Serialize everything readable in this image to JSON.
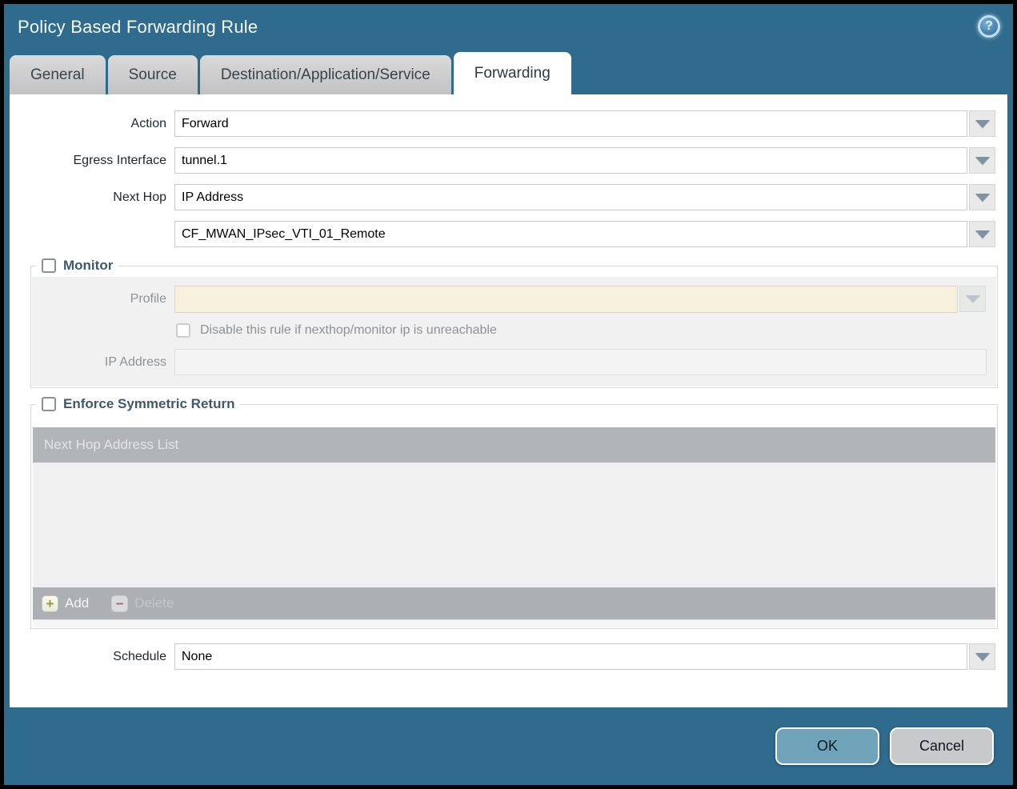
{
  "dialog": {
    "title": "Policy Based Forwarding Rule",
    "tabs": [
      {
        "label": "General"
      },
      {
        "label": "Source"
      },
      {
        "label": "Destination/Application/Service"
      },
      {
        "label": "Forwarding"
      }
    ],
    "active_tab": "Forwarding"
  },
  "form": {
    "action": {
      "label": "Action",
      "value": "Forward"
    },
    "egress_interface": {
      "label": "Egress Interface",
      "value": "tunnel.1"
    },
    "next_hop": {
      "label": "Next Hop",
      "value": "IP Address"
    },
    "next_hop_address": {
      "value": "CF_MWAN_IPsec_VTI_01_Remote"
    },
    "schedule": {
      "label": "Schedule",
      "value": "None"
    }
  },
  "monitor": {
    "legend": "Monitor",
    "checked": false,
    "profile": {
      "label": "Profile",
      "value": ""
    },
    "disable_rule": {
      "label": "Disable this rule if nexthop/monitor ip is unreachable",
      "checked": false
    },
    "ip_address": {
      "label": "IP Address",
      "value": ""
    }
  },
  "symmetric_return": {
    "legend": "Enforce Symmetric Return",
    "checked": false,
    "table": {
      "header": "Next Hop Address List",
      "rows": []
    },
    "add_label": "Add",
    "delete_label": "Delete"
  },
  "footer": {
    "ok_label": "OK",
    "cancel_label": "Cancel"
  },
  "icons": {
    "help": "question-mark-circle",
    "dropdown": "chevron-down",
    "add": "plus",
    "delete": "minus",
    "help_glyph": "?",
    "add_glyph": "+",
    "delete_glyph": "−"
  },
  "colors": {
    "background_teal": "#2F6B8C",
    "tab_gray": "#C8C8CA",
    "disabled_beige": "#F6F0DD",
    "table_header_gray": "#B1B5B9",
    "ok_button": "#6FA3B9",
    "cancel_button": "#C7C9CA"
  }
}
